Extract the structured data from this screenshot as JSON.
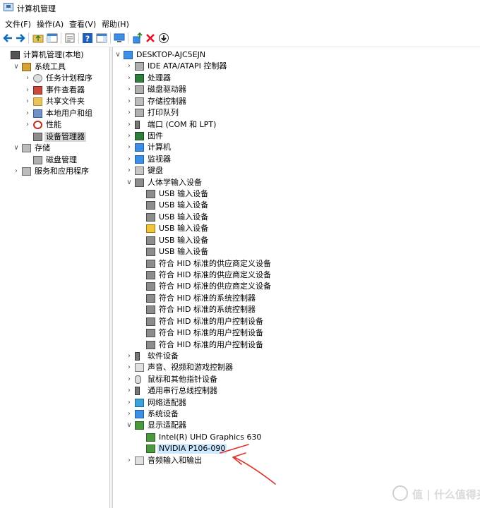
{
  "window": {
    "title": "计算机管理"
  },
  "menu": [
    "文件(F)",
    "操作(A)",
    "查看(V)",
    "帮助(H)"
  ],
  "toolbar": {
    "buttons": [
      "back-icon",
      "forward-icon",
      "up-folder-icon",
      "show-hide-tree-icon",
      "properties-icon",
      "help-icon",
      "show-hide-action-icon",
      "computer-icon",
      "update-driver-icon",
      "uninstall-icon",
      "download-icon"
    ],
    "accent": "#0f6cbd",
    "delete_color": "#e81123"
  },
  "left_tree": [
    {
      "label": "计算机管理(本地)",
      "icon": "computer-management-icon",
      "level": 0,
      "expander": ""
    },
    {
      "label": "系统工具",
      "icon": "tools-icon",
      "level": 1,
      "expander": "v"
    },
    {
      "label": "任务计划程序",
      "icon": "clock-icon",
      "level": 2,
      "expander": ">"
    },
    {
      "label": "事件查看器",
      "icon": "event-viewer-icon",
      "level": 2,
      "expander": ">"
    },
    {
      "label": "共享文件夹",
      "icon": "shared-folder-icon",
      "level": 2,
      "expander": ">"
    },
    {
      "label": "本地用户和组",
      "icon": "users-icon",
      "level": 2,
      "expander": ">"
    },
    {
      "label": "性能",
      "icon": "performance-icon",
      "level": 2,
      "expander": ">"
    },
    {
      "label": "设备管理器",
      "icon": "device-manager-icon",
      "level": 2,
      "expander": "",
      "selected": true
    },
    {
      "label": "存储",
      "icon": "storage-icon",
      "level": 1,
      "expander": "v"
    },
    {
      "label": "磁盘管理",
      "icon": "disk-management-icon",
      "level": 2,
      "expander": ""
    },
    {
      "label": "服务和应用程序",
      "icon": "services-icon",
      "level": 1,
      "expander": ">"
    }
  ],
  "device_tree": {
    "root": "DESKTOP-AJC5EJN",
    "items": [
      {
        "label": "IDE ATA/ATAPI 控制器",
        "icon": "ide-controller-icon",
        "level": 1,
        "expander": ">"
      },
      {
        "label": "处理器",
        "icon": "processor-icon",
        "level": 1,
        "expander": ">"
      },
      {
        "label": "磁盘驱动器",
        "icon": "disk-drive-icon",
        "level": 1,
        "expander": ">"
      },
      {
        "label": "存储控制器",
        "icon": "storage-controller-icon",
        "level": 1,
        "expander": ">"
      },
      {
        "label": "打印队列",
        "icon": "printer-icon",
        "level": 1,
        "expander": ">"
      },
      {
        "label": "端口 (COM 和 LPT)",
        "icon": "port-icon",
        "level": 1,
        "expander": ">"
      },
      {
        "label": "固件",
        "icon": "firmware-icon",
        "level": 1,
        "expander": ">"
      },
      {
        "label": "计算机",
        "icon": "computer-icon",
        "level": 1,
        "expander": ">"
      },
      {
        "label": "监视器",
        "icon": "monitor-icon",
        "level": 1,
        "expander": ">"
      },
      {
        "label": "键盘",
        "icon": "keyboard-icon",
        "level": 1,
        "expander": ">"
      },
      {
        "label": "人体学输入设备",
        "icon": "hid-icon",
        "level": 1,
        "expander": "v"
      },
      {
        "label": "USB 输入设备",
        "icon": "hid-icon",
        "level": 2,
        "expander": ""
      },
      {
        "label": "USB 输入设备",
        "icon": "hid-icon",
        "level": 2,
        "expander": ""
      },
      {
        "label": "USB 输入设备",
        "icon": "hid-icon",
        "level": 2,
        "expander": ""
      },
      {
        "label": "USB 输入设备",
        "icon": "hid-warning-icon",
        "level": 2,
        "expander": ""
      },
      {
        "label": "USB 输入设备",
        "icon": "hid-icon",
        "level": 2,
        "expander": ""
      },
      {
        "label": "USB 输入设备",
        "icon": "hid-icon",
        "level": 2,
        "expander": ""
      },
      {
        "label": "符合 HID 标准的供应商定义设备",
        "icon": "hid-icon",
        "level": 2,
        "expander": ""
      },
      {
        "label": "符合 HID 标准的供应商定义设备",
        "icon": "hid-icon",
        "level": 2,
        "expander": ""
      },
      {
        "label": "符合 HID 标准的供应商定义设备",
        "icon": "hid-icon",
        "level": 2,
        "expander": ""
      },
      {
        "label": "符合 HID 标准的系统控制器",
        "icon": "hid-icon",
        "level": 2,
        "expander": ""
      },
      {
        "label": "符合 HID 标准的系统控制器",
        "icon": "hid-icon",
        "level": 2,
        "expander": ""
      },
      {
        "label": "符合 HID 标准的用户控制设备",
        "icon": "hid-icon",
        "level": 2,
        "expander": ""
      },
      {
        "label": "符合 HID 标准的用户控制设备",
        "icon": "hid-icon",
        "level": 2,
        "expander": ""
      },
      {
        "label": "符合 HID 标准的用户控制设备",
        "icon": "hid-icon",
        "level": 2,
        "expander": ""
      },
      {
        "label": "软件设备",
        "icon": "software-device-icon",
        "level": 1,
        "expander": ">"
      },
      {
        "label": "声音、视频和游戏控制器",
        "icon": "audio-video-icon",
        "level": 1,
        "expander": ">"
      },
      {
        "label": "鼠标和其他指针设备",
        "icon": "mouse-icon",
        "level": 1,
        "expander": ">"
      },
      {
        "label": "通用串行总线控制器",
        "icon": "usb-icon",
        "level": 1,
        "expander": ">"
      },
      {
        "label": "网络适配器",
        "icon": "network-adapter-icon",
        "level": 1,
        "expander": ">"
      },
      {
        "label": "系统设备",
        "icon": "system-device-icon",
        "level": 1,
        "expander": ">"
      },
      {
        "label": "显示适配器",
        "icon": "display-adapter-icon",
        "level": 1,
        "expander": "v"
      },
      {
        "label": "Intel(R) UHD Graphics 630",
        "icon": "display-adapter-icon",
        "level": 2,
        "expander": ""
      },
      {
        "label": "NVIDIA P106-090",
        "icon": "display-adapter-icon",
        "level": 2,
        "expander": "",
        "highlighted": true
      },
      {
        "label": "音频输入和输出",
        "icon": "audio-io-icon",
        "level": 1,
        "expander": ">"
      }
    ]
  },
  "annotation": {
    "arrow_color": "#e0312b"
  },
  "watermark": {
    "text": "值 | 什么值得买"
  }
}
